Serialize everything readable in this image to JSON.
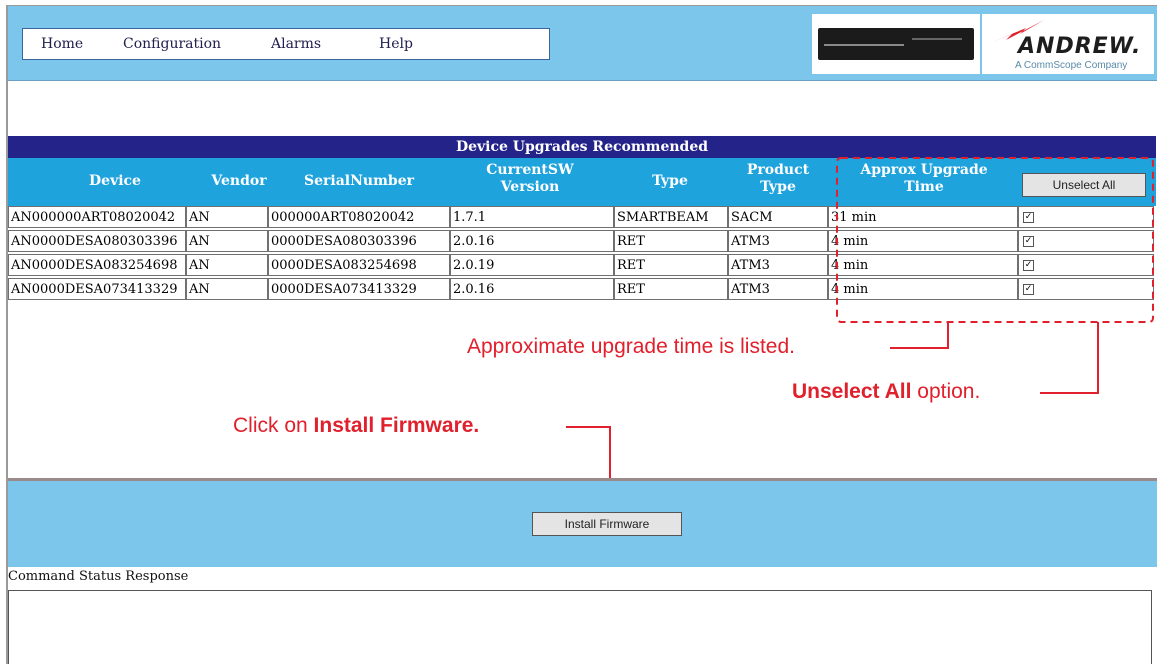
{
  "menu": {
    "home": "Home",
    "configuration": "Configuration",
    "alarms": "Alarms",
    "help": "Help"
  },
  "logo": {
    "name": "ANDREW.",
    "tagline": "A CommScope Company"
  },
  "table": {
    "caption": "Device Upgrades Recommended",
    "headers": {
      "device": "Device",
      "vendor": "Vendor",
      "serial": "SerialNumber",
      "sw_line1": "CurrentSW",
      "sw_line2": "Version",
      "type": "Type",
      "ptype_line1": "Product",
      "ptype_line2": "Type",
      "time_line1": "Approx Upgrade",
      "time_line2": "Time"
    },
    "unselect_label": "Unselect All",
    "rows": [
      {
        "device": "AN000000ART08020042",
        "vendor": "AN",
        "serial": "000000ART08020042",
        "version": "1.7.1",
        "type": "SMARTBEAM",
        "product_type": "SACM",
        "time": "31 min",
        "checked": true
      },
      {
        "device": "AN0000DESA080303396",
        "vendor": "AN",
        "serial": "0000DESA080303396",
        "version": "2.0.16",
        "type": "RET",
        "product_type": "ATM3",
        "time": "4 min",
        "checked": true
      },
      {
        "device": "AN0000DESA083254698",
        "vendor": "AN",
        "serial": "0000DESA083254698",
        "version": "2.0.19",
        "type": "RET",
        "product_type": "ATM3",
        "time": "4 min",
        "checked": true
      },
      {
        "device": "AN0000DESA073413329",
        "vendor": "AN",
        "serial": "0000DESA073413329",
        "version": "2.0.16",
        "type": "RET",
        "product_type": "ATM3",
        "time": "4 min",
        "checked": true
      }
    ]
  },
  "annotations": {
    "upgrade_time": "Approximate upgrade time is listed.",
    "unselect_bold": "Unselect All",
    "unselect_rest": " option.",
    "install_pre": "Click on ",
    "install_bold": "Install Firmware."
  },
  "install_label": "Install Firmware",
  "status_label": "Command Status Response",
  "colors": {
    "accent_red": "#e0202c",
    "header_blue": "#1fa3dc",
    "caption_navy": "#23238a",
    "band_blue": "#7cc6ec"
  }
}
